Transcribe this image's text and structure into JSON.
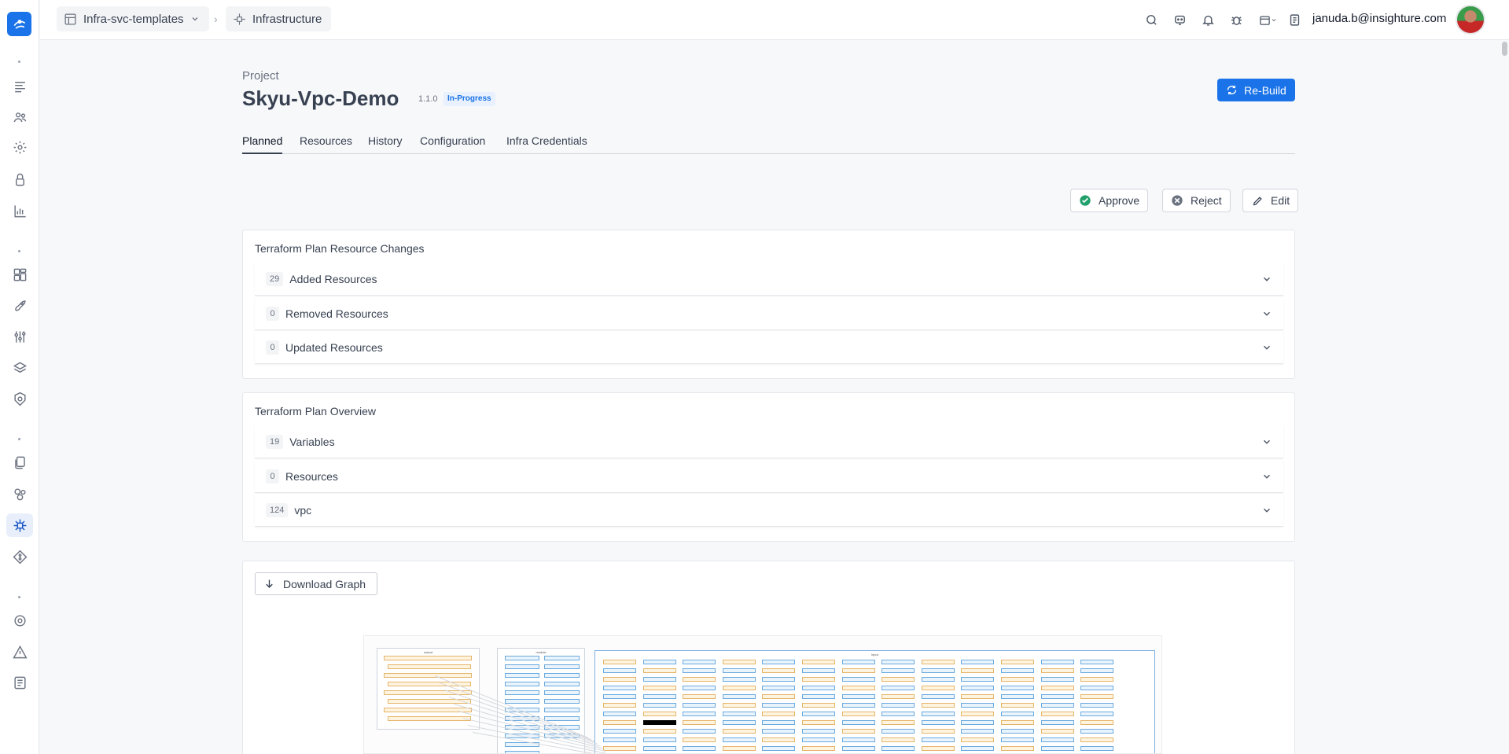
{
  "topbar": {
    "org_dropdown": "Infra-svc-templates",
    "breadcrumb_current": "Infrastructure",
    "user_email": "januda.b@insighture.com"
  },
  "project": {
    "label": "Project",
    "name": "Skyu-Vpc-Demo",
    "version": "1.1.0",
    "status": "In-Progress",
    "rebuild_label": "Re-Build"
  },
  "tabs": [
    "Planned",
    "Resources",
    "History",
    "Configuration",
    "Infra Credentials"
  ],
  "actions": {
    "approve": "Approve",
    "reject": "Reject",
    "edit": "Edit"
  },
  "plan_changes": {
    "title": "Terraform Plan Resource Changes",
    "rows": [
      {
        "count": "29",
        "label": "Added Resources"
      },
      {
        "count": "0",
        "label": "Removed Resources"
      },
      {
        "count": "0",
        "label": "Updated Resources"
      }
    ]
  },
  "plan_overview": {
    "title": "Terraform Plan Overview",
    "rows": [
      {
        "count": "19",
        "label": "Variables"
      },
      {
        "count": "0",
        "label": "Resources"
      },
      {
        "count": "124",
        "label": "vpc"
      }
    ]
  },
  "graph": {
    "download_label": "Download Graph",
    "clusters": [
      "output",
      "module",
      "input"
    ]
  },
  "colors": {
    "primary": "#1a73e8",
    "approve": "#22a06b",
    "reject": "#6b7280"
  }
}
